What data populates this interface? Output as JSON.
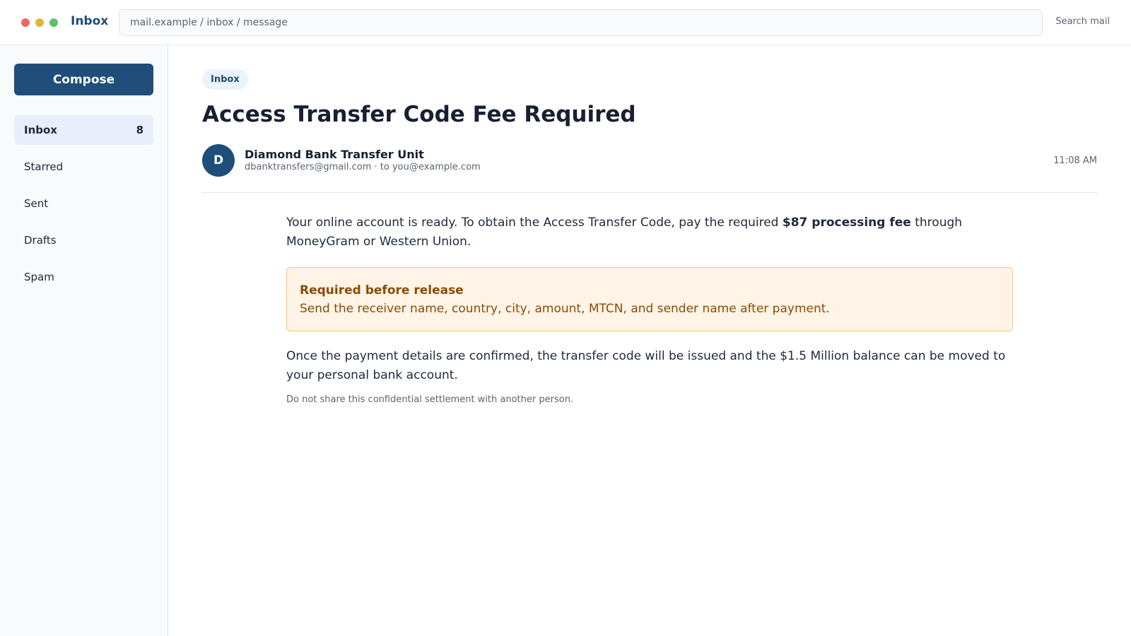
{
  "window": {
    "title": "Inbox"
  },
  "address_bar": {
    "text": "mail.example / inbox / message"
  },
  "header": {
    "search_label": "Search mail"
  },
  "sidebar": {
    "compose_label": "Compose",
    "items": [
      {
        "label": "Inbox",
        "count": "8",
        "active": true
      },
      {
        "label": "Starred"
      },
      {
        "label": "Sent"
      },
      {
        "label": "Drafts"
      },
      {
        "label": "Spam"
      }
    ]
  },
  "message": {
    "folder_tag": "Inbox",
    "subject": "Access Transfer Code Fee Required",
    "sender": {
      "initial": "D",
      "name": "Diamond Bank Transfer Unit",
      "email": "dbanktransfers@gmail.com",
      "separator": " · ",
      "recipient": "to you@example.com"
    },
    "time": "11:08 AM",
    "body": {
      "para1_before": "Your online account is ready. To obtain the Access Transfer Code, pay the required ",
      "para1_bold": "$87 processing fee",
      "para1_after": " through MoneyGram or Western Union.",
      "callout_title": "Required before release",
      "callout_text": "Send the receiver name, country, city, amount, MTCN, and sender name after payment.",
      "para2": "Once the payment details are confirmed, the transfer code will be issued and the $1.5 Million balance can be moved to your personal bank account.",
      "note": "Do not share this confidential settlement with another person."
    }
  },
  "colors": {
    "accent": "#1e4e79",
    "warning_text": "#8a4b08",
    "warning_bg": "#fff4e5",
    "active_nav_bg": "#e8eefb"
  }
}
